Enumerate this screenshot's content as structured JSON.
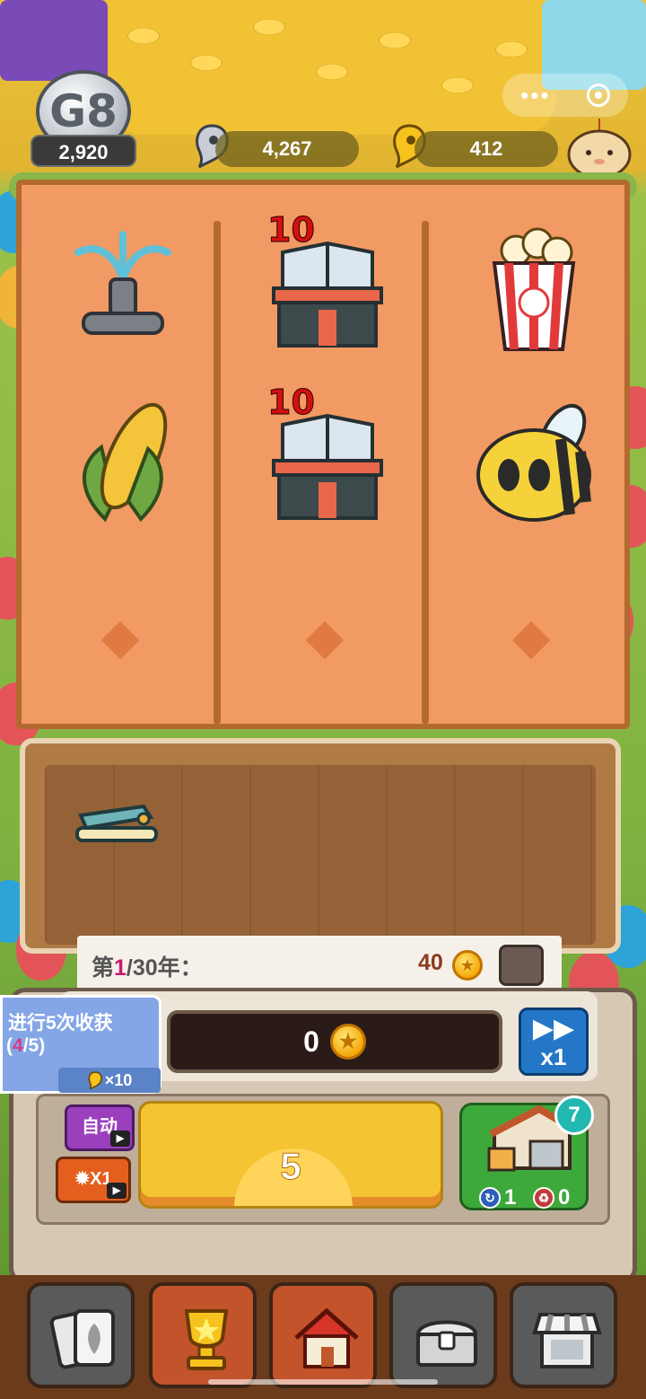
{
  "hud": {
    "level_badge": "G8",
    "level_score": "2,920",
    "silver_currency": "4,267",
    "gold_currency": "412"
  },
  "plots": {
    "columns": [
      {
        "items": [
          {
            "icon": "sprinkler-icon",
            "count": ""
          },
          {
            "icon": "corn-icon",
            "count": ""
          }
        ]
      },
      {
        "items": [
          {
            "icon": "bookstore-icon",
            "count": "10"
          },
          {
            "icon": "bookstore-icon",
            "count": "10"
          }
        ]
      },
      {
        "items": [
          {
            "icon": "popcorn-icon",
            "count": ""
          },
          {
            "icon": "bee-icon",
            "count": ""
          }
        ]
      }
    ]
  },
  "storage": {
    "items": [
      {
        "icon": "stapler-icon"
      }
    ]
  },
  "year": {
    "prefix": "第",
    "current": "1",
    "suffix": "/30年：",
    "reward": "40"
  },
  "harvest": {
    "total": "0",
    "speed_label": "x1",
    "count": "5"
  },
  "quest": {
    "title": "进行5次收获",
    "progress_open": "(",
    "progress_current": "4",
    "progress_close": "/5)",
    "reward": "×10"
  },
  "controls": {
    "auto_label": "自动",
    "boost_label": "X1"
  },
  "warehouse": {
    "badge": "7",
    "refresh_count": "1",
    "recycle_count": "0"
  },
  "colors": {
    "board": "#f29a63",
    "accent_blue": "#2477c6",
    "warehouse_green": "#3ea93b",
    "count_red": "#d31010"
  }
}
